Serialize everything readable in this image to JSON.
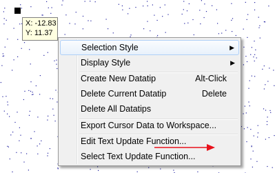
{
  "datatip": {
    "x_text": "X: -12.83",
    "y_text": "Y: 11.37"
  },
  "menu": {
    "items": [
      {
        "label": "Selection Style",
        "shortcut": "",
        "submenu": true
      },
      {
        "label": "Display Style",
        "shortcut": "",
        "submenu": true
      },
      {
        "label": "Create New Datatip",
        "shortcut": "Alt-Click",
        "submenu": false
      },
      {
        "label": "Delete Current Datatip",
        "shortcut": "Delete",
        "submenu": false
      },
      {
        "label": "Delete All Datatips",
        "shortcut": "",
        "submenu": false
      },
      {
        "label": "Export Cursor Data to Workspace...",
        "shortcut": "",
        "submenu": false
      },
      {
        "label": "Edit Text Update Function...",
        "shortcut": "",
        "submenu": false
      },
      {
        "label": "Select Text Update Function...",
        "shortcut": "",
        "submenu": false
      }
    ],
    "highlighted": "Selection Style"
  },
  "colors": {
    "points": "#1f1f9f",
    "annotation_arrow": "#e8111b",
    "highlight_border": "#aecff7"
  },
  "icons": {
    "submenu": "submenu-arrow-icon",
    "marker": "datatip-marker-icon"
  }
}
